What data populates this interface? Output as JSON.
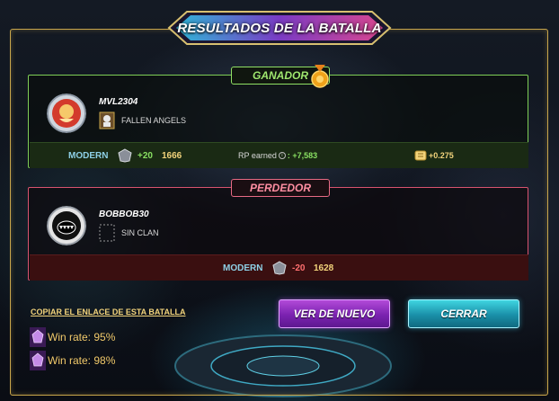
{
  "header": {
    "title": "RESULTADOS DE LA BATALLA"
  },
  "winner": {
    "label": "GANADOR",
    "player_name": "MVL2304",
    "clan_name": "FALLEN ANGELS",
    "league": "MODERN",
    "rating_delta": "+20",
    "rating": "1666",
    "rp_label": "RP earned",
    "rp_value": ": +7,583",
    "reward_value": "+0.275"
  },
  "loser": {
    "label": "PERDEDOR",
    "player_name": "BOBBOB30",
    "clan_name": "SIN CLAN",
    "league": "MODERN",
    "rating_delta": "-20",
    "rating": "1628"
  },
  "footer": {
    "copy_link": "COPIAR EL ENLACE DE ESTA BATALLA",
    "winrates": [
      "Win rate: 95%",
      "Win rate: 98%"
    ]
  },
  "buttons": {
    "rewatch": "VER DE NUEVO",
    "close": "CERRAR"
  },
  "colors": {
    "frame_gold": "#c9a64b",
    "winner_green": "#7fcf56",
    "loser_red": "#d9536f",
    "rewatch_purple": "#7a22b0",
    "close_cyan": "#1a8fa8"
  }
}
